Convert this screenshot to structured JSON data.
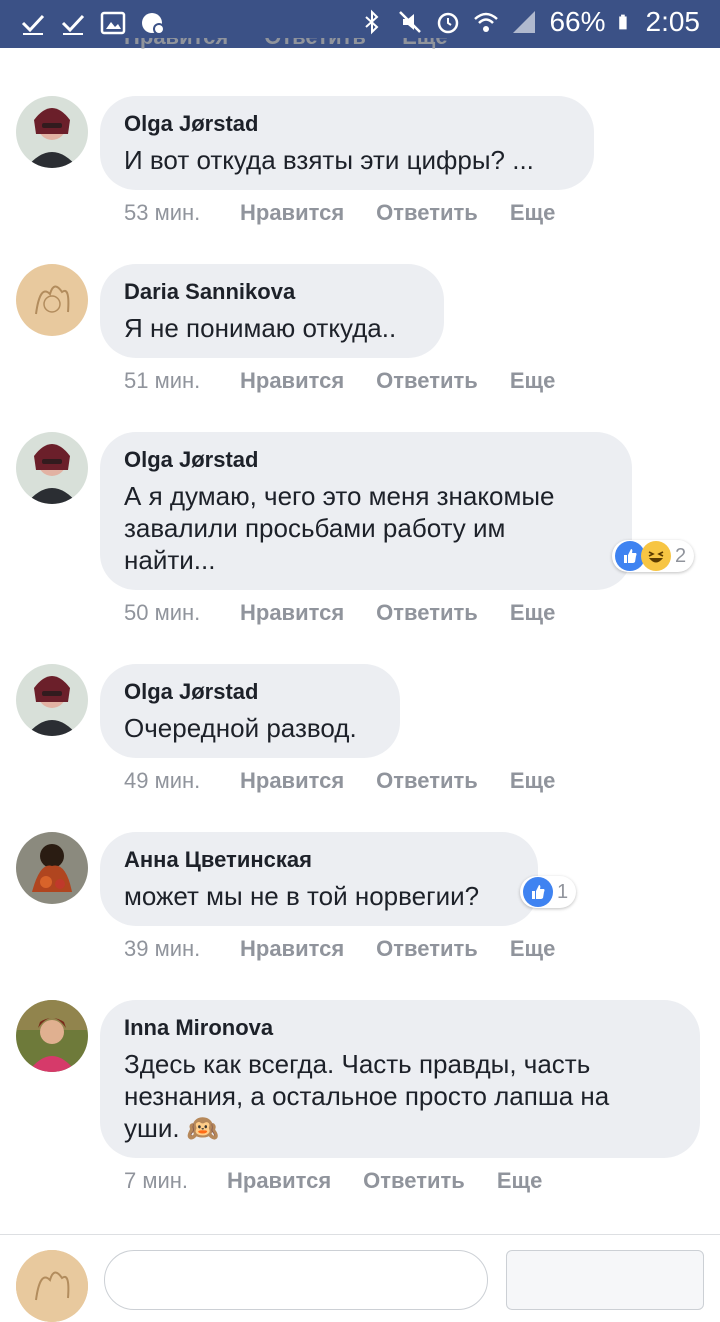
{
  "status_bar": {
    "battery": "66%",
    "time": "2:05",
    "left_icons": [
      "check-icon",
      "check-icon",
      "image-icon",
      "settings-notify-icon"
    ],
    "right_icons": [
      "bluetooth-icon",
      "mute-icon",
      "alarm-icon",
      "wifi-icon",
      "signal-icon",
      "battery-icon"
    ]
  },
  "cut_row": {
    "like": "Нравится",
    "reply": "Ответить",
    "more": "Еще"
  },
  "comments": [
    {
      "author": "Olga Jørstad",
      "text": "И вот откуда взяты эти цифры? ...",
      "time": "53 мин.",
      "like": "Нравится",
      "reply": "Ответить",
      "more": "Еще"
    },
    {
      "author": "Daria Sannikova",
      "text": "Я не понимаю откуда..",
      "time": "51 мин.",
      "like": "Нравится",
      "reply": "Ответить",
      "more": "Еще"
    },
    {
      "author": "Olga Jørstad",
      "text": "А я думаю, чего это меня знакомые\nзавалили просьбами работу им\nнайти...",
      "time": "50 мин.",
      "like": "Нравится",
      "reply": "Ответить",
      "more": "Еще",
      "reaction_count": "2"
    },
    {
      "author": "Olga Jørstad",
      "text": "Очередной развод.",
      "time": "49 мин.",
      "like": "Нравится",
      "reply": "Ответить",
      "more": "Еще"
    },
    {
      "author": "Анна Цветинская",
      "text": "может мы не в той норвегии?",
      "time": "39 мин.",
      "like": "Нравится",
      "reply": "Ответить",
      "more": "Еще",
      "reaction_count": "1"
    },
    {
      "author": "Inna Mironova",
      "text": "Здесь как всегда. Часть правды, часть\nнезнания, а остальное просто лапша на\nуши. 🙉",
      "time": "7 мин.",
      "like": "Нравится",
      "reply": "Ответить",
      "more": "Еще"
    }
  ],
  "colors": {
    "status_bar": "#3b5186",
    "bubble": "#eceef2",
    "meta_text": "#90949c",
    "like_blue": "#3f83f1"
  }
}
